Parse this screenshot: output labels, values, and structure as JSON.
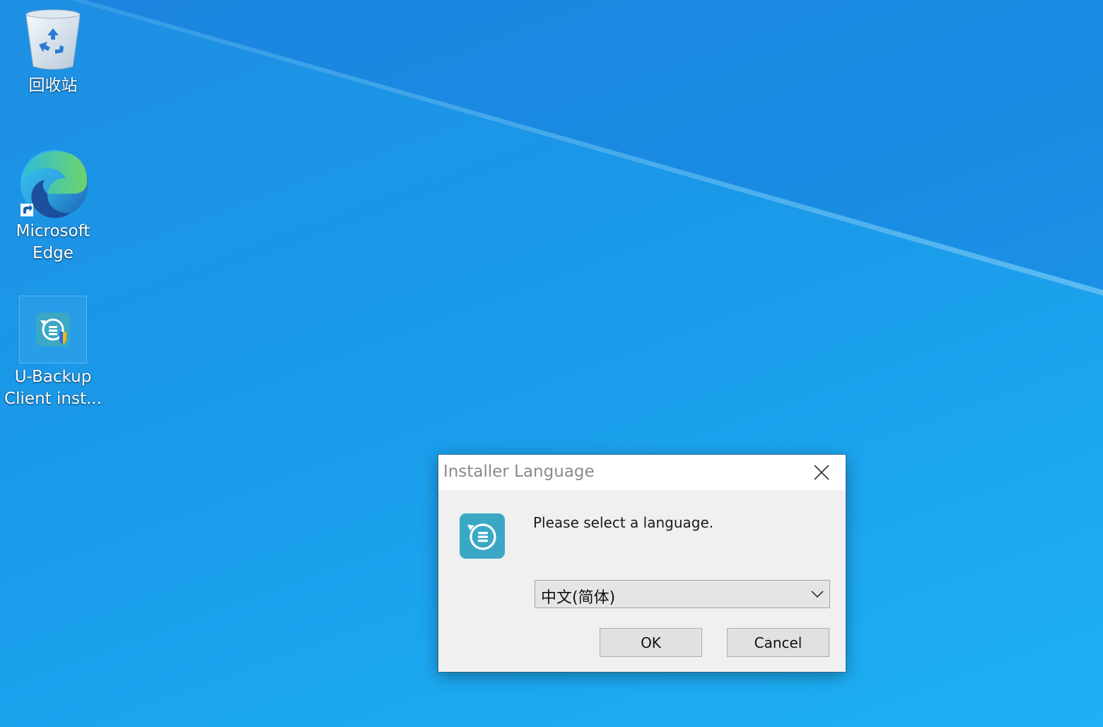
{
  "desktop": {
    "icons": [
      {
        "label": "回收站",
        "icon": "recycle-bin-icon"
      },
      {
        "label": "Microsoft\nEdge",
        "icon": "edge-icon"
      },
      {
        "label": "U-Backup\nClient inst...",
        "icon": "ubackup-installer-icon"
      }
    ]
  },
  "dialog": {
    "title": "Installer Language",
    "prompt": "Please select a language.",
    "language_select": {
      "selected": "中文(简体)"
    },
    "ok_label": "OK",
    "cancel_label": "Cancel"
  },
  "colors": {
    "desktop_blue": "#1a9ae9",
    "dialog_bg": "#f0f0f0",
    "app_icon_teal": "#3aa8c4"
  }
}
